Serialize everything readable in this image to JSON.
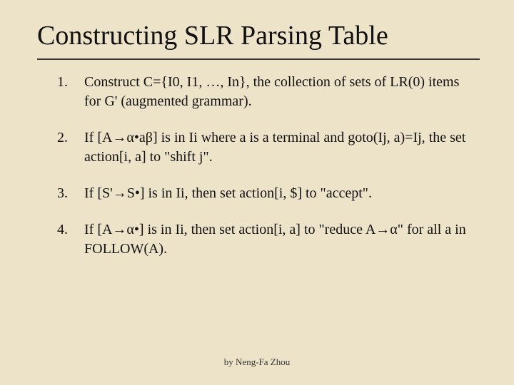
{
  "title": "Constructing SLR Parsing Table",
  "items": [
    {
      "num": "1.",
      "text": "Construct C={I0, I1, …, In}, the collection of sets of LR(0) items for G' (augmented grammar)."
    },
    {
      "num": "2.",
      "text": "If [A→α•aβ] is in Ii where a is a terminal and goto(Ij, a)=Ij, the set action[i, a] to \"shift j\"."
    },
    {
      "num": "3.",
      "text": "If [S'→S•] is in Ii, then set action[i, $] to \"accept\"."
    },
    {
      "num": "4.",
      "text": "If [A→α•] is in Ii, then set action[i, a] to \"reduce A→α\"  for all a in FOLLOW(A)."
    }
  ],
  "footer": "by Neng-Fa Zhou"
}
